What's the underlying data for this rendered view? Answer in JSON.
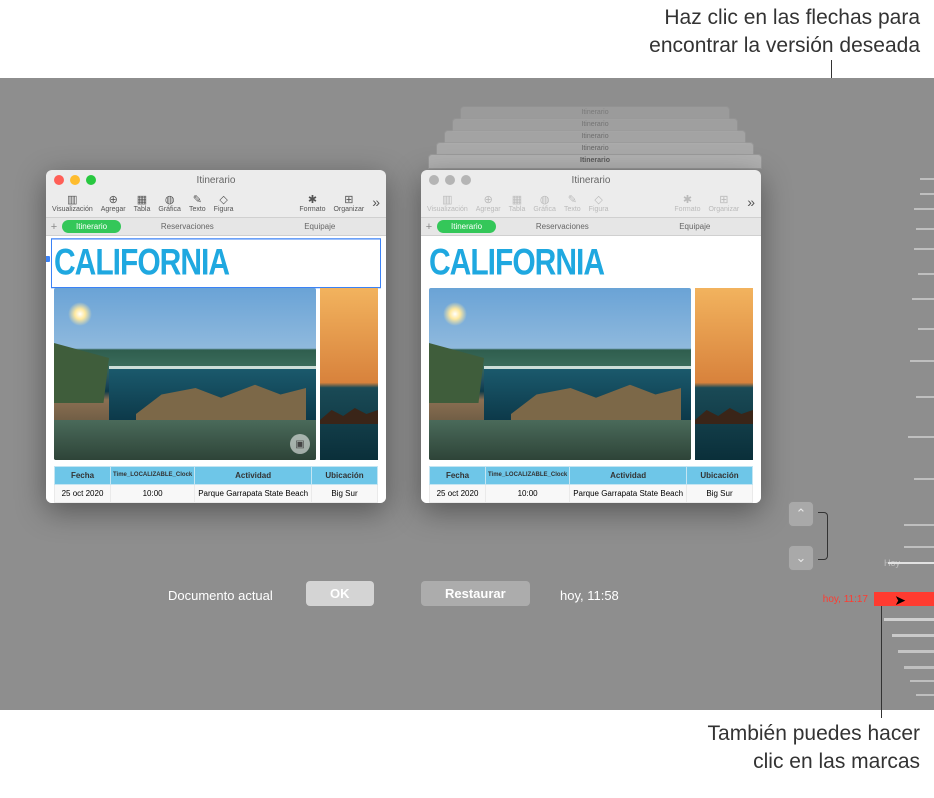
{
  "callouts": {
    "top": "Haz clic en las flechas para\nencontrar la versión deseada",
    "bottom": "También puedes hacer\nclic en las marcas"
  },
  "window": {
    "title": "Itinerario",
    "toolbar": {
      "visualizacion": "Visualización",
      "agregar": "Agregar",
      "tabla": "Tabla",
      "grafica": "Gráfica",
      "texto": "Texto",
      "figura": "Figura",
      "formato": "Formato",
      "organizar": "Organizar"
    },
    "tabs": {
      "itinerario": "Itinerario",
      "reservaciones": "Reservaciones",
      "equipaje": "Equipaje"
    },
    "headline": "CALIFORNIA",
    "table": {
      "headers": {
        "fecha": "Fecha",
        "clock": "Time_LOCALIZABLE_Clock",
        "actividad": "Actividad",
        "ubicacion": "Ubicación"
      },
      "row": {
        "fecha": "25 oct 2020",
        "clock": "10:00",
        "actividad": "Parque Garrapata State Beach",
        "ubicacion": "Big Sur"
      }
    }
  },
  "ghosts": [
    "Itinerario",
    "Itinerario",
    "Itinerario",
    "Itinerario",
    "Itinerario"
  ],
  "controls": {
    "current_label": "Documento actual",
    "ok": "OK",
    "restore": "Restaurar",
    "version_time": "hoy, 11:58"
  },
  "timeline": {
    "today": "Hoy",
    "selected": "hoy, 11:17"
  }
}
